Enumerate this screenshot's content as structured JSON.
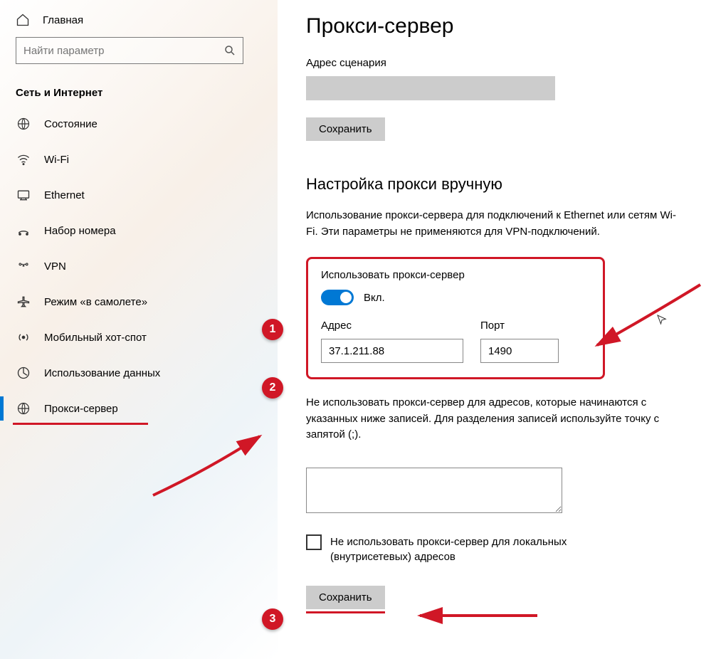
{
  "sidebar": {
    "home": "Главная",
    "search_placeholder": "Найти параметр",
    "section": "Сеть и Интернет",
    "items": [
      {
        "label": "Состояние"
      },
      {
        "label": "Wi-Fi"
      },
      {
        "label": "Ethernet"
      },
      {
        "label": "Набор номера"
      },
      {
        "label": "VPN"
      },
      {
        "label": "Режим «в самолете»"
      },
      {
        "label": "Мобильный хот-спот"
      },
      {
        "label": "Использование данных"
      },
      {
        "label": "Прокси-сервер"
      }
    ]
  },
  "main": {
    "title": "Прокси-сервер",
    "script_address_label": "Адрес сценария",
    "save1": "Сохранить",
    "manual_title": "Настройка прокси вручную",
    "manual_desc": "Использование прокси-сервера для подключений к Ethernet или сетям Wi-Fi. Эти параметры не применяются для VPN-подключений.",
    "use_proxy_label": "Использовать прокси-сервер",
    "toggle_state": "Вкл.",
    "address_label": "Адрес",
    "address_value": "37.1.211.88",
    "port_label": "Порт",
    "port_value": "1490",
    "exceptions_desc": "Не использовать прокси-сервер для адресов, которые начинаются с указанных ниже записей. Для разделения записей используйте точку с запятой (;).",
    "local_checkbox": "Не использовать прокси-сервер для локальных (внутрисетевых) адресов",
    "save2": "Сохранить"
  },
  "badges": {
    "b1": "1",
    "b2": "2",
    "b3": "3"
  }
}
